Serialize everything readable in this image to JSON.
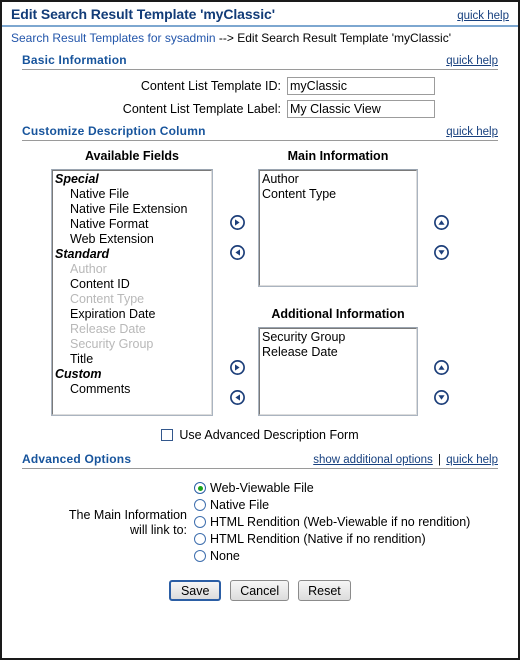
{
  "window": {
    "title": "Edit Search Result Template 'myClassic'",
    "quick_help": "quick help"
  },
  "breadcrumb": {
    "link": "Search Result Templates for sysadmin",
    "separator": "-->",
    "current": "Edit Search Result Template 'myClassic'"
  },
  "basic_information": {
    "title": "Basic Information",
    "quick_help": "quick help",
    "fields": [
      {
        "label": "Content List Template ID:",
        "value": "myClassic",
        "placeholder": ""
      },
      {
        "label": "Content List Template Label:",
        "value": "My Classic View",
        "placeholder": ""
      }
    ]
  },
  "customize_description_column": {
    "title": "Customize Description Column",
    "quick_help": "quick help",
    "available": {
      "title": "Available Fields",
      "items": [
        {
          "label": "Special",
          "type": "group",
          "disabled": false
        },
        {
          "label": "Native File",
          "type": "item",
          "disabled": false
        },
        {
          "label": "Native File Extension",
          "type": "item",
          "disabled": false
        },
        {
          "label": "Native Format",
          "type": "item",
          "disabled": false
        },
        {
          "label": "Web Extension",
          "type": "item",
          "disabled": false
        },
        {
          "label": "Standard",
          "type": "group",
          "disabled": false
        },
        {
          "label": "Author",
          "type": "item",
          "disabled": true
        },
        {
          "label": "Content ID",
          "type": "item",
          "disabled": false
        },
        {
          "label": "Content Type",
          "type": "item",
          "disabled": true
        },
        {
          "label": "Expiration Date",
          "type": "item",
          "disabled": false
        },
        {
          "label": "Release Date",
          "type": "item",
          "disabled": true
        },
        {
          "label": "Security Group",
          "type": "item",
          "disabled": true
        },
        {
          "label": "Title",
          "type": "item",
          "disabled": false
        },
        {
          "label": "Custom",
          "type": "group",
          "disabled": false
        },
        {
          "label": "Comments",
          "type": "item",
          "disabled": false
        }
      ]
    },
    "main_information": {
      "title": "Main Information",
      "items": [
        "Author",
        "Content Type"
      ]
    },
    "additional_information": {
      "title": "Additional Information",
      "items": [
        "Security Group",
        "Release Date"
      ]
    },
    "icons": {
      "add": "arrow-right-icon",
      "remove": "arrow-left-icon",
      "move_up": "arrow-up-icon",
      "move_down": "arrow-down-icon"
    },
    "advanced_description_checkbox": {
      "label": "Use Advanced Description Form",
      "checked": false
    }
  },
  "advanced_options": {
    "title": "Advanced Options",
    "show_additional_options": "show additional options",
    "link_divider": "|",
    "quick_help": "quick help",
    "link_label_line1": "The Main Information",
    "link_label_line2": "will link to:",
    "options": [
      {
        "label": "Web-Viewable File",
        "selected": true
      },
      {
        "label": "Native File",
        "selected": false
      },
      {
        "label": "HTML Rendition (Web-Viewable if no rendition)",
        "selected": false
      },
      {
        "label": "HTML Rendition (Native if no rendition)",
        "selected": false
      },
      {
        "label": "None",
        "selected": false
      }
    ]
  },
  "buttons": {
    "save": "Save",
    "cancel": "Cancel",
    "reset": "Reset"
  },
  "colors": {
    "title_blue": "#123c78",
    "section_blue": "#17549c",
    "link_blue": "#2255aa",
    "radio_selected_dot": "#19a419",
    "arrow_button": "#1d3f7a"
  }
}
